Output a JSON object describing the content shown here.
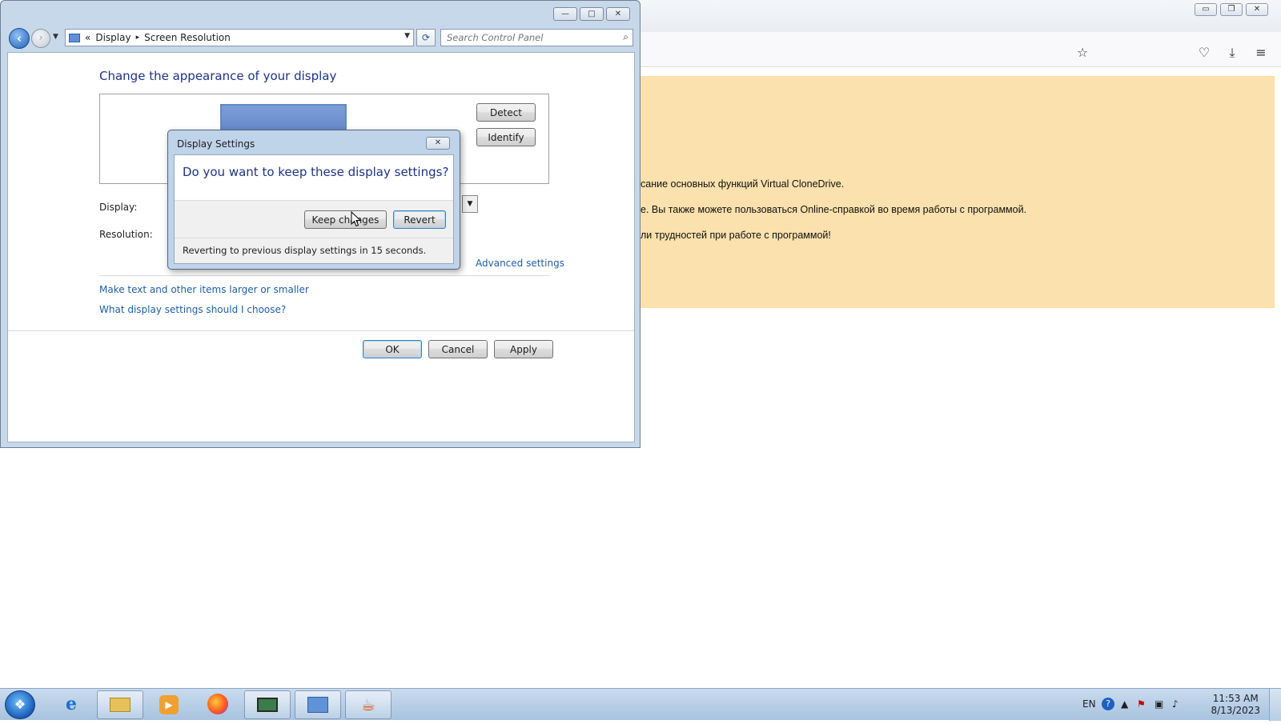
{
  "browser": {
    "controls": {
      "minimize": "▭",
      "restore": "❐",
      "close": "✕"
    },
    "toolbar_icons": {
      "bookmark": "☆",
      "pocket": "♡",
      "download": "⤓",
      "menu": "≡"
    },
    "notice_lines": [
      "сание основных функций Virtual CloneDrive.",
      "е. Вы также можете пользоваться Online-справкой во время работы с программой.",
      "ли трудностей при работе с программой!"
    ]
  },
  "control_panel": {
    "controls": {
      "minimize": "—",
      "maximize": "□",
      "close": "✕"
    },
    "breadcrumb": {
      "chevrons": "«",
      "item1": "Display",
      "sep": "▸",
      "item2": "Screen Resolution"
    },
    "search_placeholder": "Search Control Panel",
    "heading": "Change the appearance of your display",
    "detect_label": "Detect",
    "identify_label": "Identify",
    "display_label": "Display:",
    "resolution_label": "Resolution:",
    "advanced_link": "Advanced settings",
    "link_text_size": "Make text and other items larger or smaller",
    "link_help": "What display settings should I choose?",
    "ok_label": "OK",
    "cancel_label": "Cancel",
    "apply_label": "Apply"
  },
  "dialog": {
    "title": "Display Settings",
    "question": "Do you want to keep these display settings?",
    "keep_label": "Keep changes",
    "revert_label": "Revert",
    "info": "Reverting to previous display settings in 15 seconds."
  },
  "taskbar": {
    "language": "EN",
    "time": "11:53 AM",
    "date": "8/13/2023"
  }
}
